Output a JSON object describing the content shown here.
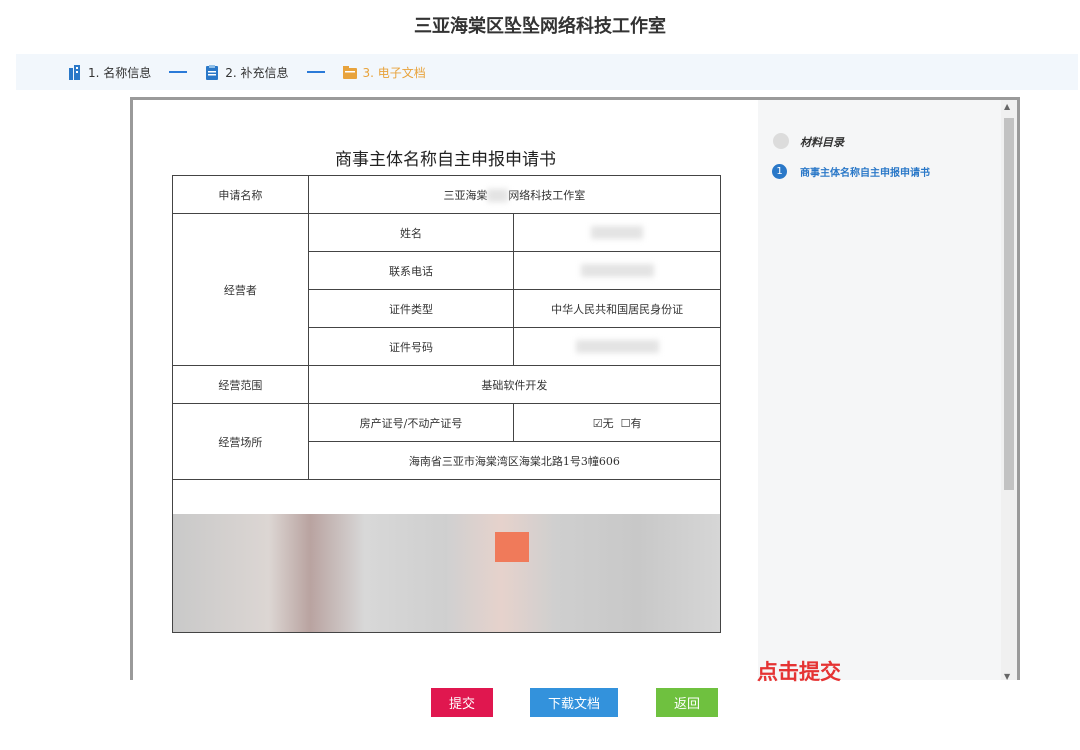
{
  "header": {
    "title": "三亚海棠区坠坠网络科技工作室"
  },
  "steps": [
    {
      "label": "1. 名称信息"
    },
    {
      "label": "2. 补充信息"
    },
    {
      "label": "3. 电子文档"
    }
  ],
  "document": {
    "title": "商事主体名称自主申报申请书",
    "rows": {
      "app_name_label": "申请名称",
      "app_name_value_left": "三亚海棠",
      "app_name_value_right": "网络科技工作室",
      "operator_label": "经营者",
      "name_label": "姓名",
      "phone_label": "联系电话",
      "id_type_label": "证件类型",
      "id_type_value": "中华人民共和国居民身份证",
      "id_number_label": "证件号码",
      "scope_label": "经营范围",
      "scope_value": "基础软件开发",
      "premises_label": "经营场所",
      "property_label": "房产证号/不动产证号",
      "opt_none": "无",
      "opt_have": "有",
      "address_value": "海南省三亚市海棠湾区海棠北路1号3幢606"
    }
  },
  "toc": {
    "title": "材料目录",
    "items": [
      {
        "num": "1",
        "label": "商事主体名称自主申报申请书"
      }
    ]
  },
  "annotation": "点击提交",
  "buttons": {
    "submit": "提交",
    "download": "下载文档",
    "back": "返回"
  },
  "colors": {
    "submit": "#e0174f",
    "download": "#3392dc",
    "back": "#6fc13f",
    "accent": "#2a78c8",
    "active_step": "#e8a33c"
  }
}
